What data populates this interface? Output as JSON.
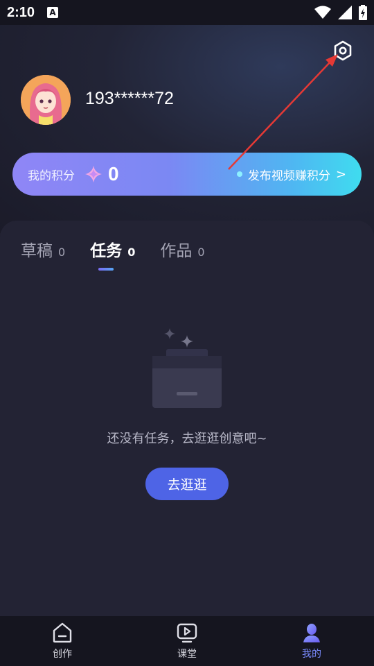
{
  "status_bar": {
    "time": "2:10",
    "badge": "A"
  },
  "profile": {
    "phone": "193******72"
  },
  "points": {
    "label": "我的积分",
    "value": "0",
    "publish_label": "发布视频赚积分",
    "chevron": ">"
  },
  "tabs": [
    {
      "label": "草稿",
      "count": "0"
    },
    {
      "label": "任务",
      "count": "0"
    },
    {
      "label": "作品",
      "count": "0"
    }
  ],
  "empty": {
    "message": "还没有任务，去逛逛创意吧~",
    "button": "去逛逛"
  },
  "bottom_nav": [
    {
      "label": "创作"
    },
    {
      "label": "课堂"
    },
    {
      "label": "我的"
    }
  ],
  "colors": {
    "accent": "#4e64e6",
    "active_nav": "#7b8cff",
    "annotation_arrow": "#e53935"
  }
}
